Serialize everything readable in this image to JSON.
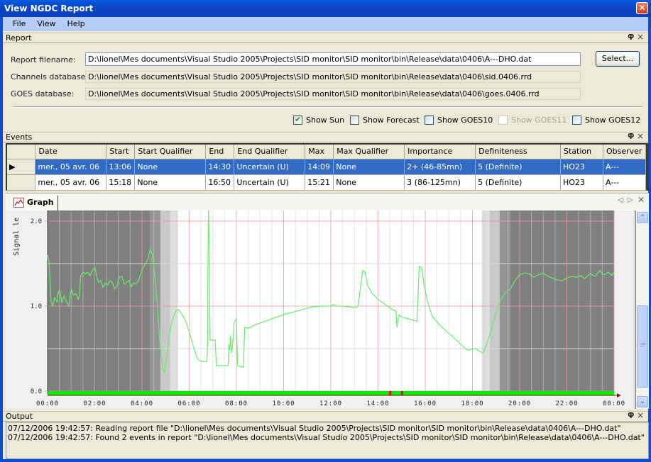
{
  "window": {
    "title": "View NGDC Report",
    "close_icon": "close-icon"
  },
  "menu": {
    "items": [
      "File",
      "View",
      "Help"
    ]
  },
  "report_panel": {
    "title": "Report",
    "report_filename_label": "Report filename:",
    "report_filename_value": "D:\\lionel\\Mes documents\\Visual Studio 2005\\Projects\\SID monitor\\SID monitor\\bin\\Release\\data\\0406\\A---DHO.dat",
    "channels_db_label": "Channels database:",
    "channels_db_value": "D:\\lionel\\Mes documents\\Visual Studio 2005\\Projects\\SID monitor\\SID monitor\\bin\\Release\\data\\0406\\sid.0406.rrd",
    "goes_db_label": "GOES database:",
    "goes_db_value": "D:\\lionel\\Mes documents\\Visual Studio 2005\\Projects\\SID monitor\\SID monitor\\bin\\Release\\data\\0406\\goes.0406.rrd",
    "select_button": "Select...",
    "checkboxes": [
      {
        "label": "Show Sun",
        "checked": true,
        "enabled": true
      },
      {
        "label": "Show Forecast",
        "checked": false,
        "enabled": true
      },
      {
        "label": "Show GOES10",
        "checked": false,
        "enabled": true
      },
      {
        "label": "Show GOES11",
        "checked": false,
        "enabled": false
      },
      {
        "label": "Show GOES12",
        "checked": false,
        "enabled": true
      }
    ]
  },
  "events_panel": {
    "title": "Events",
    "columns": [
      "Date",
      "Start",
      "Start Qualifier",
      "End",
      "End Qualifier",
      "Max",
      "Max Qualifier",
      "Importance",
      "Definiteness",
      "Station",
      "Observer"
    ],
    "rows": [
      {
        "selected": true,
        "cells": [
          "mer., 05 avr. 06",
          "13:06",
          "None",
          "14:30",
          "Uncertain (U)",
          "14:09",
          "None",
          "2+ (46-85mn)",
          "5 (Definite)",
          "HO23",
          "A---"
        ]
      },
      {
        "selected": false,
        "cells": [
          "mer., 05 avr. 06",
          "15:18",
          "None",
          "16:50",
          "Uncertain (U)",
          "15:21",
          "None",
          "3 (86-125mn)",
          "5 (Definite)",
          "HO23",
          "A---"
        ]
      }
    ]
  },
  "graph_tab": {
    "label": "Graph"
  },
  "chart_data": {
    "type": "line",
    "title": "",
    "ylabel": "Signal level",
    "xlabel": "",
    "x_ticks": [
      "00:00",
      "02:00",
      "04:00",
      "06:00",
      "08:00",
      "10:00",
      "12:00",
      "14:00",
      "16:00",
      "18:00",
      "20:00",
      "22:00",
      "00:00"
    ],
    "y_ticks": [
      "0.0",
      "1.0",
      "2.0"
    ],
    "xlim_hours": [
      0,
      24
    ],
    "ylim": [
      0,
      2.1
    ],
    "colors": {
      "signal": "#66ee66",
      "night": "#808080",
      "grid_major": "#e8a0a0",
      "grid_minor": "#dddddd",
      "status_bar": "#00ee00",
      "event_marker": "#ee0000"
    },
    "sun_shading": [
      {
        "from": 0,
        "to": 4.33,
        "level": "night"
      },
      {
        "from": 4.33,
        "to": 4.78,
        "level": "astronomical"
      },
      {
        "from": 4.78,
        "to": 5.2,
        "level": "nautical"
      },
      {
        "from": 5.2,
        "to": 5.52,
        "level": "civil"
      },
      {
        "from": 18.4,
        "to": 18.73,
        "level": "civil"
      },
      {
        "from": 18.73,
        "to": 19.15,
        "level": "nautical"
      },
      {
        "from": 19.15,
        "to": 19.6,
        "level": "astronomical"
      },
      {
        "from": 19.6,
        "to": 24,
        "level": "night"
      }
    ],
    "event_markers_hours": [
      14.5,
      15.0
    ],
    "series": [
      {
        "name": "Signal",
        "points": [
          [
            0.0,
            1.6
          ],
          [
            0.05,
            1.52
          ],
          [
            0.1,
            1.35
          ],
          [
            0.15,
            1.05
          ],
          [
            0.22,
            1.0
          ],
          [
            0.3,
            1.1
          ],
          [
            0.4,
            1.05
          ],
          [
            0.45,
            1.16
          ],
          [
            0.52,
            1.18
          ],
          [
            0.6,
            1.04
          ],
          [
            0.7,
            1.12
          ],
          [
            0.8,
            1.05
          ],
          [
            0.9,
            1.0
          ],
          [
            1.0,
            1.2
          ],
          [
            1.1,
            1.13
          ],
          [
            1.2,
            1.15
          ],
          [
            1.3,
            1.08
          ],
          [
            1.35,
            1.12
          ],
          [
            1.4,
            1.35
          ],
          [
            1.5,
            1.4
          ],
          [
            1.6,
            1.38
          ],
          [
            1.7,
            1.4
          ],
          [
            1.8,
            1.36
          ],
          [
            1.9,
            1.42
          ],
          [
            2.0,
            1.45
          ],
          [
            2.08,
            1.35
          ],
          [
            2.15,
            1.28
          ],
          [
            2.25,
            1.3
          ],
          [
            2.35,
            1.22
          ],
          [
            2.45,
            1.27
          ],
          [
            2.55,
            1.25
          ],
          [
            2.65,
            1.3
          ],
          [
            2.75,
            1.27
          ],
          [
            2.85,
            1.2
          ],
          [
            2.95,
            1.25
          ],
          [
            3.05,
            1.34
          ],
          [
            3.15,
            1.35
          ],
          [
            3.25,
            1.26
          ],
          [
            3.35,
            1.28
          ],
          [
            3.45,
            1.3
          ],
          [
            3.55,
            1.23
          ],
          [
            3.65,
            1.27
          ],
          [
            3.75,
            1.26
          ],
          [
            3.85,
            1.3
          ],
          [
            3.95,
            1.38
          ],
          [
            4.05,
            1.45
          ],
          [
            4.15,
            1.5
          ],
          [
            4.25,
            1.55
          ],
          [
            4.35,
            1.67
          ],
          [
            4.45,
            1.6
          ],
          [
            4.55,
            1.35
          ],
          [
            4.65,
            1.0
          ],
          [
            4.75,
            0.6
          ],
          [
            4.85,
            0.3
          ],
          [
            4.95,
            0.22
          ],
          [
            5.05,
            0.4
          ],
          [
            5.15,
            0.65
          ],
          [
            5.3,
            0.85
          ],
          [
            5.45,
            0.95
          ],
          [
            5.55,
            0.96
          ],
          [
            5.7,
            0.9
          ],
          [
            5.85,
            0.83
          ],
          [
            6.0,
            0.7
          ],
          [
            6.2,
            0.5
          ],
          [
            6.35,
            0.38
          ],
          [
            6.5,
            0.35
          ],
          [
            6.75,
            0.35
          ],
          [
            6.78,
            0.55
          ],
          [
            6.8,
            1.7
          ],
          [
            6.82,
            2.6
          ],
          [
            6.85,
            1.7
          ],
          [
            6.88,
            0.6
          ],
          [
            7.1,
            0.6
          ],
          [
            7.15,
            0.3
          ],
          [
            7.65,
            0.3
          ],
          [
            7.68,
            0.55
          ],
          [
            7.72,
            0.48
          ],
          [
            7.75,
            0.65
          ],
          [
            7.8,
            0.45
          ],
          [
            7.85,
            0.58
          ],
          [
            7.9,
            0.8
          ],
          [
            8.0,
            0.85
          ],
          [
            8.05,
            0.3
          ],
          [
            8.3,
            0.28
          ],
          [
            8.35,
            0.75
          ],
          [
            8.5,
            0.74
          ],
          [
            8.8,
            0.78
          ],
          [
            9.2,
            0.82
          ],
          [
            9.6,
            0.86
          ],
          [
            10.0,
            0.9
          ],
          [
            10.4,
            0.93
          ],
          [
            10.8,
            0.96
          ],
          [
            11.2,
            0.99
          ],
          [
            11.6,
            1.0
          ],
          [
            12.0,
            1.0
          ],
          [
            12.1,
            1.02
          ],
          [
            12.25,
            1.0
          ],
          [
            12.5,
            1.0
          ],
          [
            12.8,
            0.99
          ],
          [
            13.05,
            0.98
          ],
          [
            13.15,
            1.0
          ],
          [
            13.3,
            1.3
          ],
          [
            13.35,
            1.42
          ],
          [
            13.45,
            1.4
          ],
          [
            13.55,
            1.25
          ],
          [
            13.75,
            1.15
          ],
          [
            14.0,
            1.08
          ],
          [
            14.3,
            1.02
          ],
          [
            14.6,
            0.96
          ],
          [
            14.76,
            0.94
          ],
          [
            14.8,
            0.75
          ],
          [
            14.85,
            0.85
          ],
          [
            14.9,
            0.9
          ],
          [
            15.0,
            0.87
          ],
          [
            15.3,
            0.85
          ],
          [
            15.55,
            0.83
          ],
          [
            15.65,
            0.82
          ],
          [
            15.7,
            1.15
          ],
          [
            15.75,
            1.47
          ],
          [
            15.85,
            1.45
          ],
          [
            15.95,
            1.25
          ],
          [
            16.1,
            1.05
          ],
          [
            16.3,
            0.88
          ],
          [
            16.6,
            0.78
          ],
          [
            17.0,
            0.68
          ],
          [
            17.4,
            0.58
          ],
          [
            17.7,
            0.5
          ],
          [
            17.85,
            0.48
          ],
          [
            18.0,
            0.5
          ],
          [
            18.15,
            0.5
          ],
          [
            18.3,
            0.47
          ],
          [
            18.45,
            0.45
          ],
          [
            18.6,
            0.55
          ],
          [
            18.8,
            0.72
          ],
          [
            19.0,
            0.92
          ],
          [
            19.2,
            1.08
          ],
          [
            19.4,
            1.16
          ],
          [
            19.6,
            1.2
          ],
          [
            19.8,
            1.3
          ],
          [
            20.0,
            1.37
          ],
          [
            20.2,
            1.39
          ],
          [
            20.4,
            1.38
          ],
          [
            20.6,
            1.34
          ],
          [
            20.8,
            1.37
          ],
          [
            21.0,
            1.39
          ],
          [
            21.2,
            1.35
          ],
          [
            21.4,
            1.33
          ],
          [
            21.55,
            1.31
          ],
          [
            21.8,
            1.3
          ],
          [
            22.0,
            1.33
          ],
          [
            22.2,
            1.35
          ],
          [
            22.4,
            1.34
          ],
          [
            22.6,
            1.36
          ],
          [
            22.75,
            1.32
          ],
          [
            22.85,
            1.35
          ],
          [
            23.0,
            1.38
          ],
          [
            23.2,
            1.35
          ],
          [
            23.4,
            1.42
          ],
          [
            23.5,
            1.38
          ],
          [
            23.6,
            1.37
          ],
          [
            23.75,
            1.4
          ],
          [
            23.9,
            1.36
          ],
          [
            24.0,
            1.4
          ]
        ]
      }
    ]
  },
  "output_panel": {
    "title": "Output",
    "lines": [
      "07/12/2006 19:42:57:  Reading report file \"D:\\lionel\\Mes documents\\Visual Studio 2005\\Projects\\SID monitor\\SID monitor\\bin\\Release\\data\\0406\\A---DHO.dat\"",
      "07/12/2006 19:42:57:  Found 2 events in report \"D:\\lionel\\Mes documents\\Visual Studio 2005\\Projects\\SID monitor\\SID monitor\\bin\\Release\\data\\0406\\A---DHO.dat\""
    ]
  }
}
